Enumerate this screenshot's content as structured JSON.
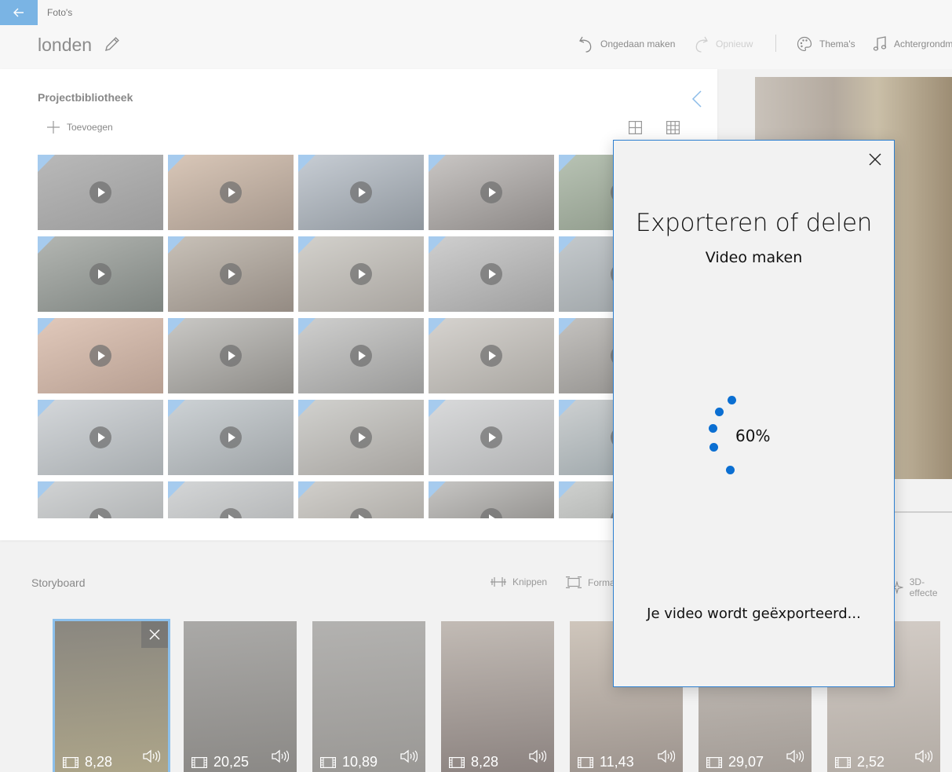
{
  "window": {
    "app_title": "Foto's"
  },
  "header": {
    "project_name": "londen"
  },
  "toolbar": {
    "undo": "Ongedaan maken",
    "redo": "Opnieuw",
    "themes": "Thema's",
    "music": "Achtergrondm"
  },
  "library": {
    "title": "Projectbibliotheek",
    "add_label": "Toevoegen",
    "thumbs": [
      {
        "c1": "#b9b9b9",
        "c2": "#9a9a9a"
      },
      {
        "c1": "#d9c7b8",
        "c2": "#a5978c"
      },
      {
        "c1": "#c7cdd4",
        "c2": "#8f969d"
      },
      {
        "c1": "#c9c6c4",
        "c2": "#8d8987"
      },
      {
        "c1": "#b8c3b4",
        "c2": "#8a9586"
      },
      {
        "c1": "#b3b6b2",
        "c2": "#7e8480"
      },
      {
        "c1": "#c8c1b8",
        "c2": "#948b83"
      },
      {
        "c1": "#d3d1cc",
        "c2": "#a8a49f"
      },
      {
        "c1": "#cfcfcf",
        "c2": "#9f9f9f"
      },
      {
        "c1": "#c4c9cc",
        "c2": "#9aa0a3"
      },
      {
        "c1": "#e1c9bb",
        "c2": "#b79f92"
      },
      {
        "c1": "#c9c8c5",
        "c2": "#8e8c88"
      },
      {
        "c1": "#cfcfce",
        "c2": "#9a9a99"
      },
      {
        "c1": "#d6d3cf",
        "c2": "#a9a6a1"
      },
      {
        "c1": "#c4c2bf",
        "c2": "#8e8c89"
      },
      {
        "c1": "#d4d7da",
        "c2": "#a7acaf"
      },
      {
        "c1": "#cdd2d5",
        "c2": "#9ea3a6"
      },
      {
        "c1": "#d1d1ce",
        "c2": "#a6a39f"
      },
      {
        "c1": "#d9dadb",
        "c2": "#b1b2b3"
      },
      {
        "c1": "#cdd0d1",
        "c2": "#97a1a5"
      },
      {
        "c1": "#d1d3d4",
        "c2": "#a4a7a8"
      },
      {
        "c1": "#d4d6d7",
        "c2": "#a8aaab"
      },
      {
        "c1": "#d1cfcb",
        "c2": "#a19e99"
      },
      {
        "c1": "#c7c6c4",
        "c2": "#7f7d7a"
      },
      {
        "c1": "#cfd1cf",
        "c2": "#9d9f9d"
      }
    ]
  },
  "storyboard": {
    "title": "Storyboard",
    "trim": "Knippen",
    "resize": "Forma",
    "effects": "3D-effecte",
    "clips": [
      {
        "duration": "8,28",
        "c1": "#8a8780",
        "c2": "#ada589"
      },
      {
        "duration": "20,25",
        "c1": "#aaa9a7",
        "c2": "#8b8986"
      },
      {
        "duration": "10,89",
        "c1": "#b3b2b0",
        "c2": "#9a9895"
      },
      {
        "duration": "8,28",
        "c1": "#c2bbb5",
        "c2": "#8c8380"
      },
      {
        "duration": "11,43",
        "c1": "#cfc6bc",
        "c2": "#9d948e"
      },
      {
        "duration": "29,07",
        "c1": "#c9c3bd",
        "c2": "#a39c96"
      },
      {
        "duration": "2,52",
        "c1": "#d3ccc6",
        "c2": "#b3aca5"
      }
    ]
  },
  "dialog": {
    "title": "Exporteren of delen",
    "subtitle": "Video maken",
    "progress_text": "60%",
    "progress": 0.6,
    "status": "Je video wordt geëxporteerd..."
  }
}
